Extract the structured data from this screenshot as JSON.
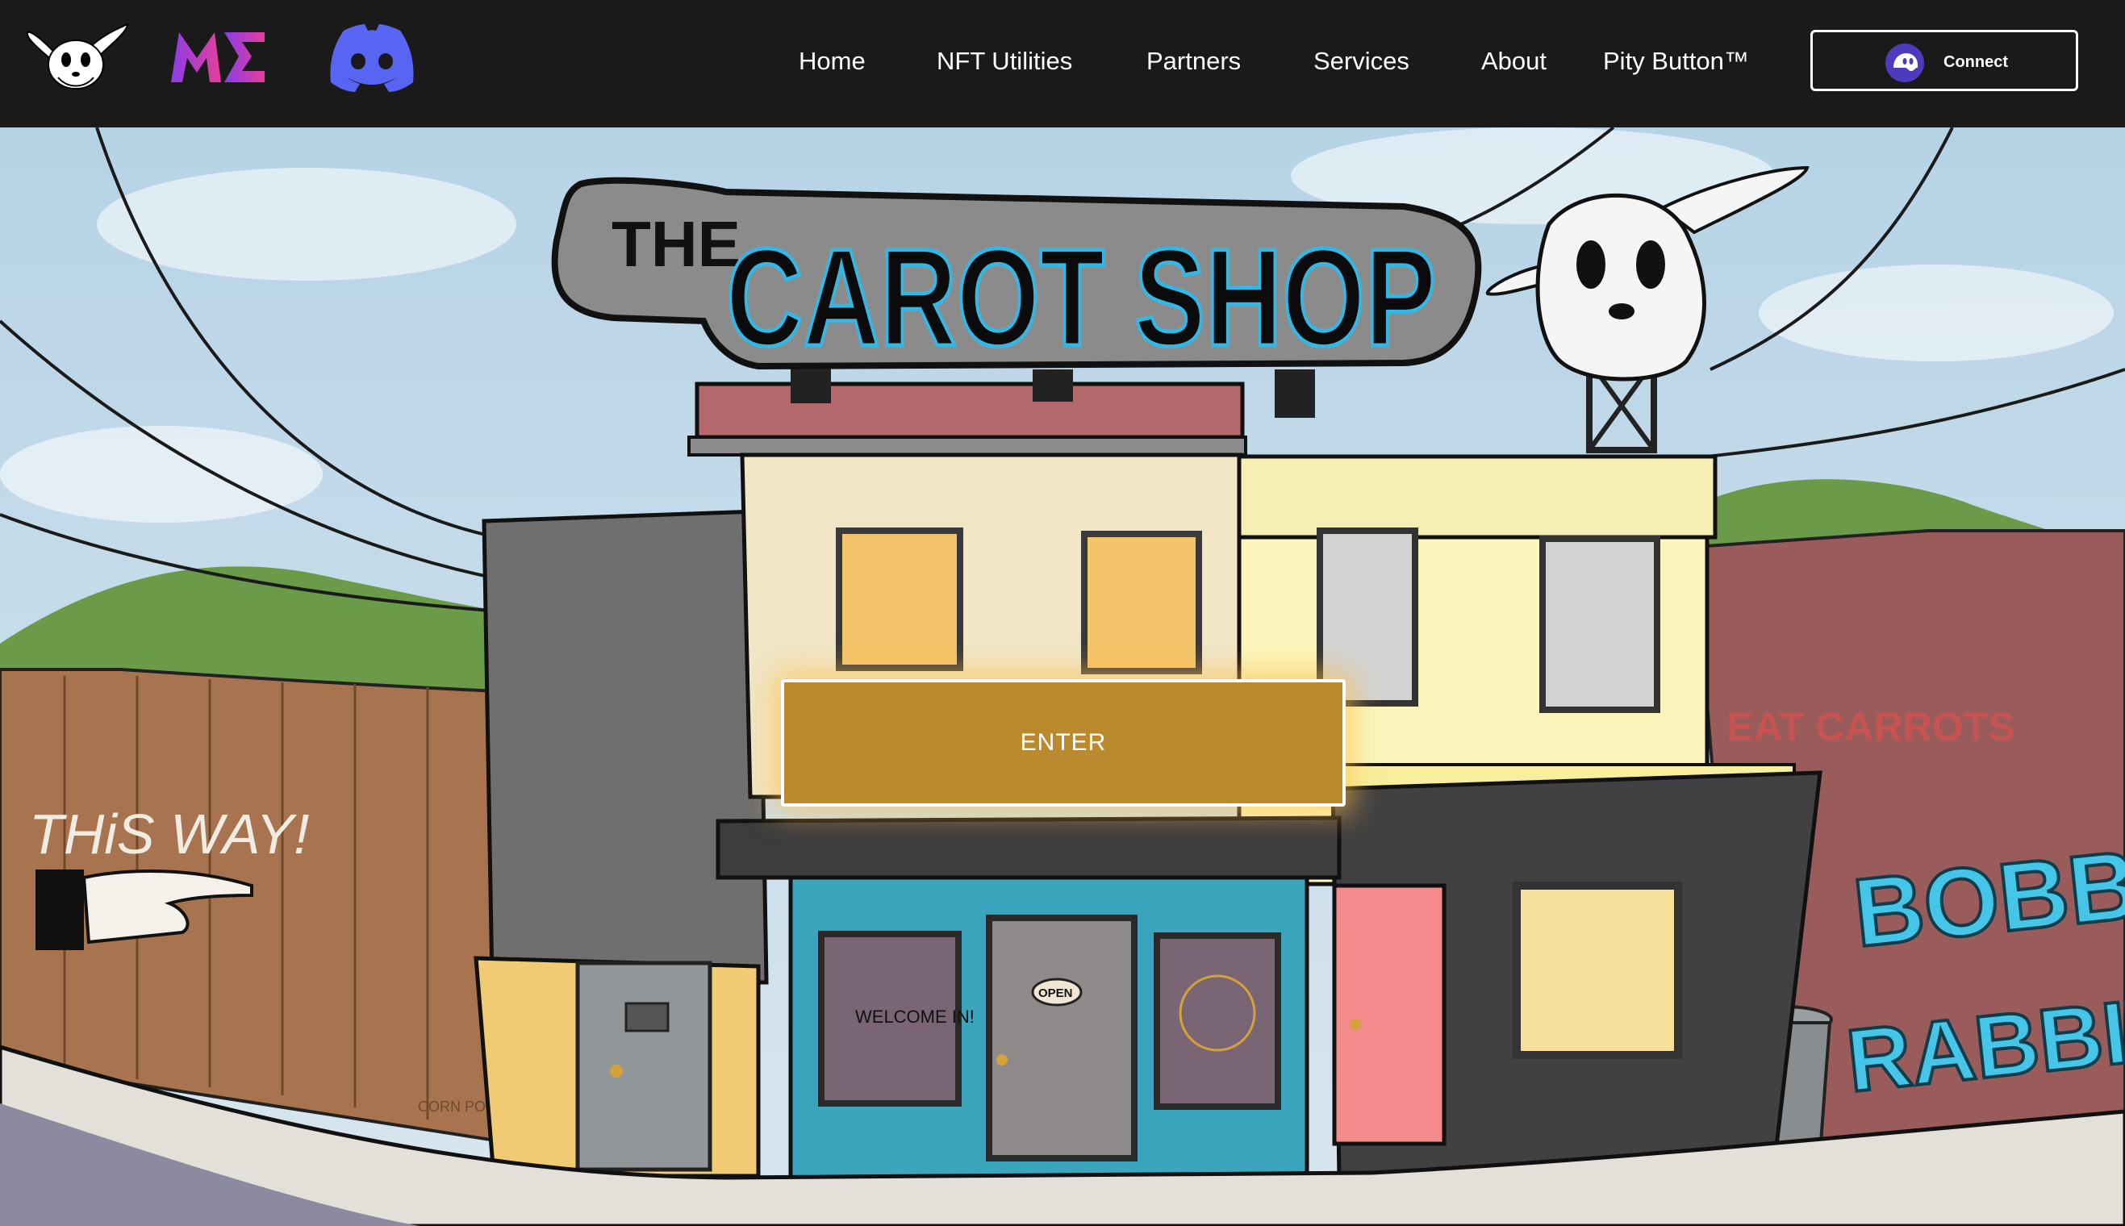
{
  "header": {
    "logos": [
      {
        "name": "rabbit-mascot-logo"
      },
      {
        "name": "magic-eden-logo",
        "text": "ME",
        "gradient": [
          "#8a3ee6",
          "#e53f9a"
        ]
      },
      {
        "name": "discord-icon",
        "color": "#5865f2"
      }
    ],
    "nav": [
      {
        "label": "Home"
      },
      {
        "label": "NFT Utilities"
      },
      {
        "label": "Partners"
      },
      {
        "label": "Services"
      },
      {
        "label": "About"
      },
      {
        "label": "Pity Button™"
      }
    ],
    "connect": {
      "label": "Connect",
      "icon": "phantom-wallet-icon",
      "icon_color": "#4c3bbd"
    }
  },
  "hero": {
    "sign": {
      "small": "THE",
      "big": "CAROT SHOP"
    },
    "graffiti_left": "THiS WAY!",
    "graffiti_right": [
      "BOBBY",
      "RABBITS"
    ],
    "graffiti_red": "EAT CARROTS",
    "window_text": "WELCOME IN!",
    "door_sign": "OPEN",
    "artist_tag": "CORN POP",
    "enter_label": "ENTER",
    "colors": {
      "sky": "#c5dbe8",
      "fence": "#a8744f",
      "teal_shop": "#3aa5bd",
      "enter": "#bb8a2e",
      "sign": "#8b8b8b",
      "sign_glow": "#33b8e6"
    }
  }
}
